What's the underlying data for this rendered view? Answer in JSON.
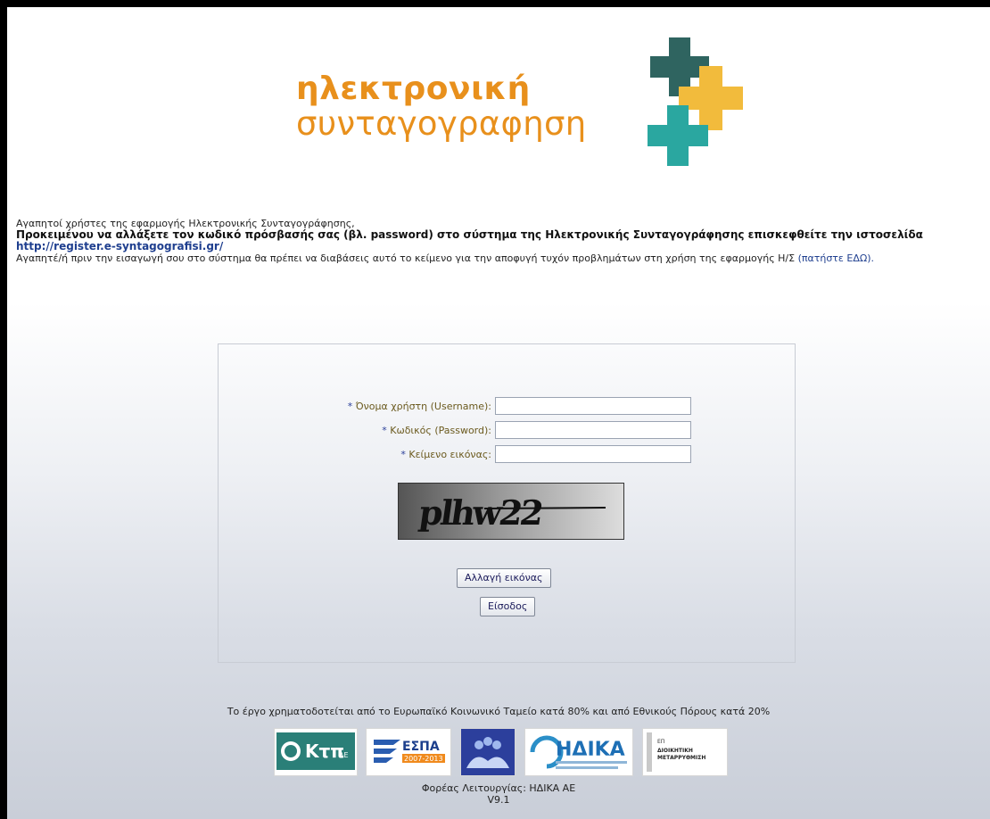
{
  "logo": {
    "line1": "ηλεκτρονική",
    "line2": "συνταγογραφηση",
    "colors": {
      "orange": "#e8901c",
      "dark_teal": "#2f6460",
      "teal": "#2aa7a0",
      "yellow": "#f2bb3c"
    }
  },
  "notice": {
    "greeting": "Αγαπητοί χρήστες της εφαρμογής Ηλεκτρονικής Συνταγογράφησης,",
    "password_change": "Προκειμένου να αλλάξετε τον κωδικό πρόσβασής σας (βλ. password) στο σύστημα της Ηλεκτρονικής Συνταγογράφησης επισκεφθείτε την ιστοσελίδα",
    "register_link": "http://register.e-syntagografisi.gr/",
    "read_text": "Αγαπητέ/ή πριν την εισαγωγή σου στο σύστημα θα πρέπει να διαβάσεις αυτό το κείμενο για την αποφυγή τυχόν προβλημάτων στη χρήση της εφαρμογής Η/Σ",
    "read_link": "(πατήστε ΕΔΩ)."
  },
  "login": {
    "required_mark": "*",
    "username_label": "Όνομα χρήστη (Username):",
    "password_label": "Κωδικός (Password):",
    "captcha_label": "Κείμενο εικόνας:",
    "username_value": "",
    "password_value": "",
    "captcha_value": "",
    "captcha_text": "plhw22",
    "change_image_button": "Αλλαγή εικόνας",
    "login_button": "Είσοδος"
  },
  "footer": {
    "funding": "Το έργο χρηματοδοτείται από το Ευρωπαϊκό Κοινωνικό Ταμείο κατά 80% και από Εθνικούς Πόρους κατά 20%",
    "sponsors": {
      "ktp": {
        "mark": "Κτπ",
        "suffix": "ΑΕ"
      },
      "espa": {
        "name": "ΕΣΠΑ",
        "years": "2007-2013"
      },
      "idika": {
        "name": "ΗΔΙΚΑ"
      },
      "ep": {
        "prefix": "ΕΠ",
        "line1": "ΔΙΟΙΚΗΤΙΚΗ",
        "line2": "ΜΕΤΑΡΡΥΘΜΙΣΗ"
      }
    },
    "operator": "Φορέας Λειτουργίας: ΗΔΙΚΑ ΑΕ",
    "version": "V9.1"
  }
}
